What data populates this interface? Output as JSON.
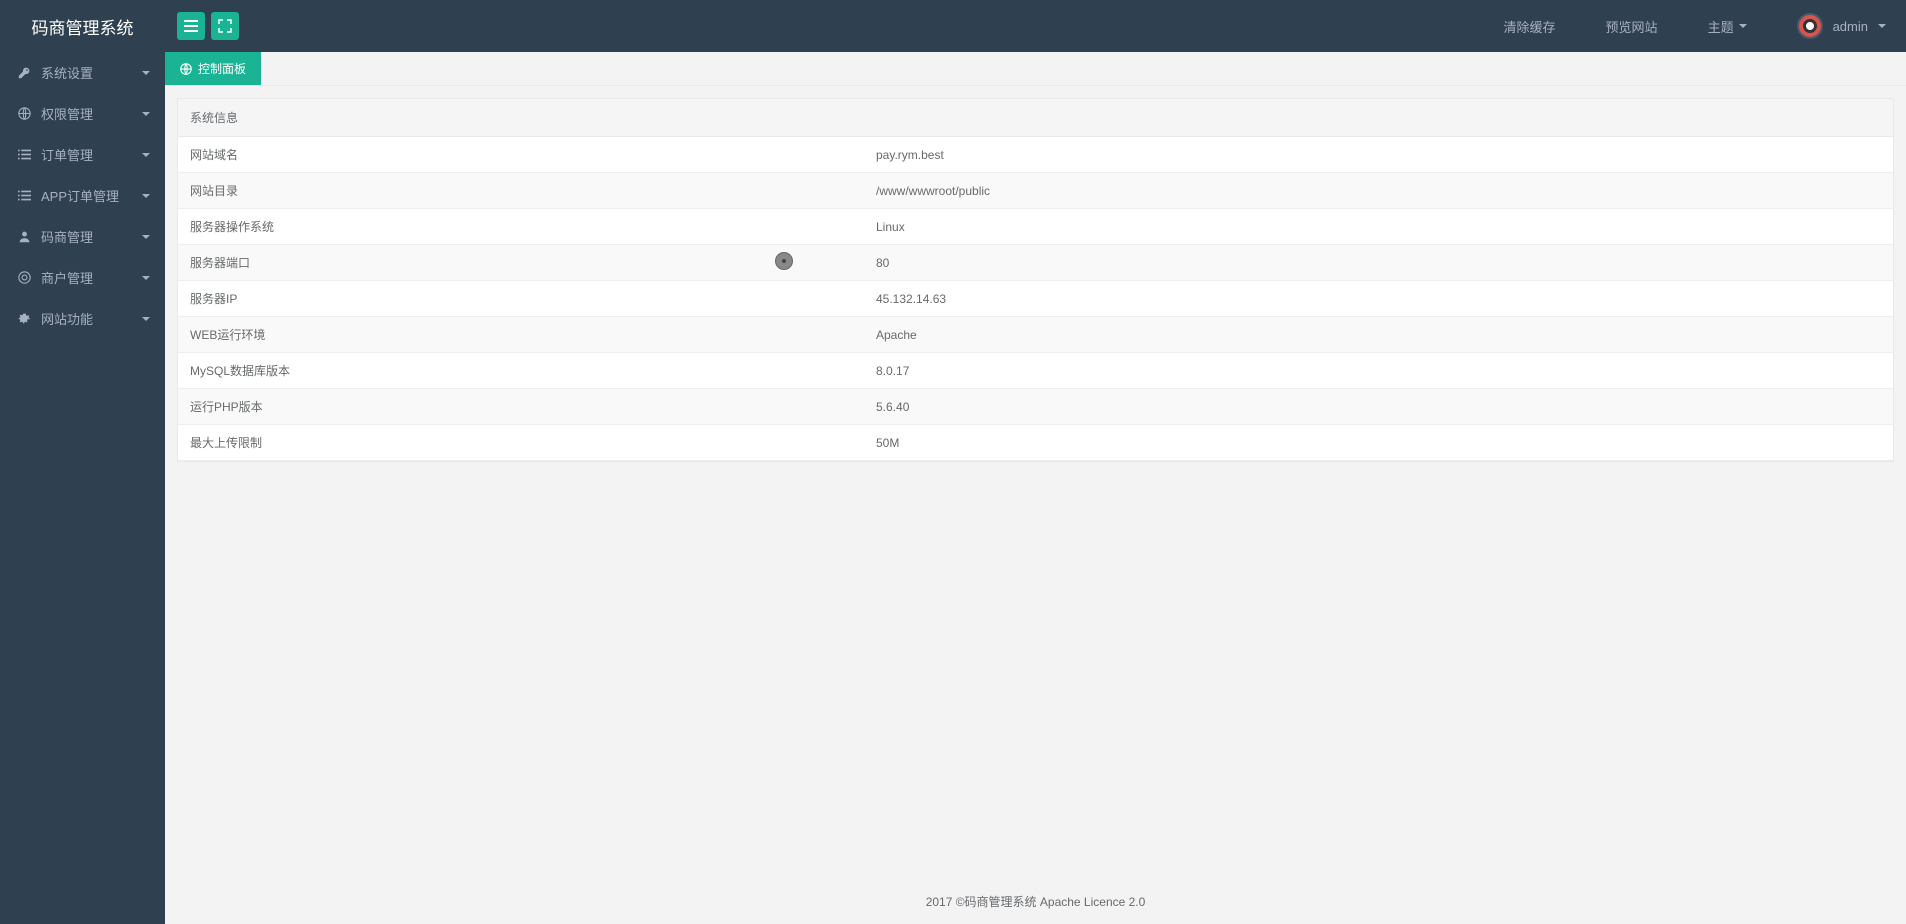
{
  "app": {
    "title": "码商管理系统"
  },
  "header": {
    "clear_cache": "清除缓存",
    "preview_site": "预览网站",
    "theme": "主题",
    "username": "admin"
  },
  "sidebar": {
    "items": [
      {
        "label": "系统设置",
        "icon": "key"
      },
      {
        "label": "权限管理",
        "icon": "globe"
      },
      {
        "label": "订单管理",
        "icon": "list"
      },
      {
        "label": "APP订单管理",
        "icon": "list"
      },
      {
        "label": "码商管理",
        "icon": "user"
      },
      {
        "label": "商户管理",
        "icon": "target"
      },
      {
        "label": "网站功能",
        "icon": "gear"
      }
    ]
  },
  "tab": {
    "label": "控制面板"
  },
  "panel": {
    "title": "系统信息",
    "rows": [
      {
        "label": "网站域名",
        "value": "pay.rym.best"
      },
      {
        "label": "网站目录",
        "value": "/www/wwwroot/public"
      },
      {
        "label": "服务器操作系统",
        "value": "Linux"
      },
      {
        "label": "服务器端口",
        "value": "80"
      },
      {
        "label": "服务器IP",
        "value": "45.132.14.63"
      },
      {
        "label": "WEB运行环境",
        "value": "Apache"
      },
      {
        "label": "MySQL数据库版本",
        "value": "8.0.17"
      },
      {
        "label": "运行PHP版本",
        "value": "5.6.40"
      },
      {
        "label": "最大上传限制",
        "value": "50M"
      }
    ]
  },
  "footer": {
    "text": "2017 ©码商管理系统 Apache Licence 2.0"
  }
}
